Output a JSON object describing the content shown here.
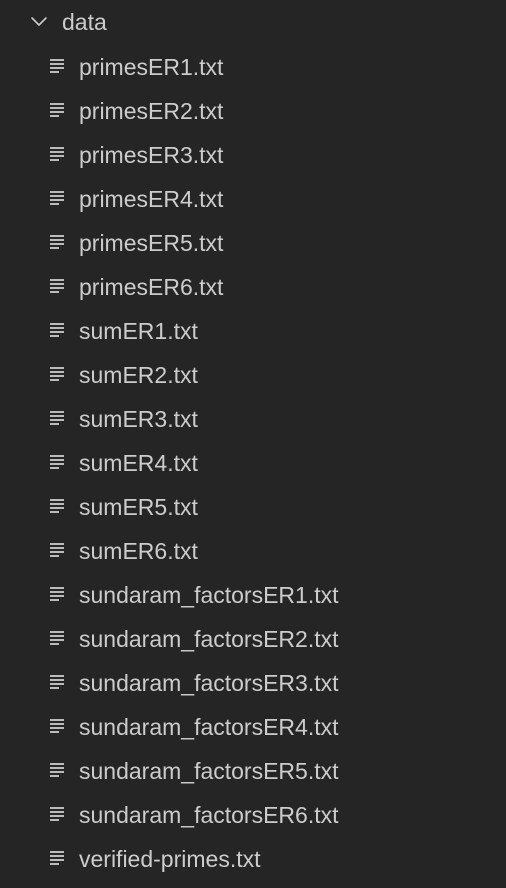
{
  "explorer": {
    "folder": {
      "label": "data",
      "expanded": true,
      "icon": "chevron-down-icon"
    },
    "file_icon": "lines-file-icon",
    "colors": {
      "background": "#252526",
      "text": "#cccccc"
    },
    "files": [
      "primesER1.txt",
      "primesER2.txt",
      "primesER3.txt",
      "primesER4.txt",
      "primesER5.txt",
      "primesER6.txt",
      "sumER1.txt",
      "sumER2.txt",
      "sumER3.txt",
      "sumER4.txt",
      "sumER5.txt",
      "sumER6.txt",
      "sundaram_factorsER1.txt",
      "sundaram_factorsER2.txt",
      "sundaram_factorsER3.txt",
      "sundaram_factorsER4.txt",
      "sundaram_factorsER5.txt",
      "sundaram_factorsER6.txt",
      "verified-primes.txt"
    ]
  }
}
